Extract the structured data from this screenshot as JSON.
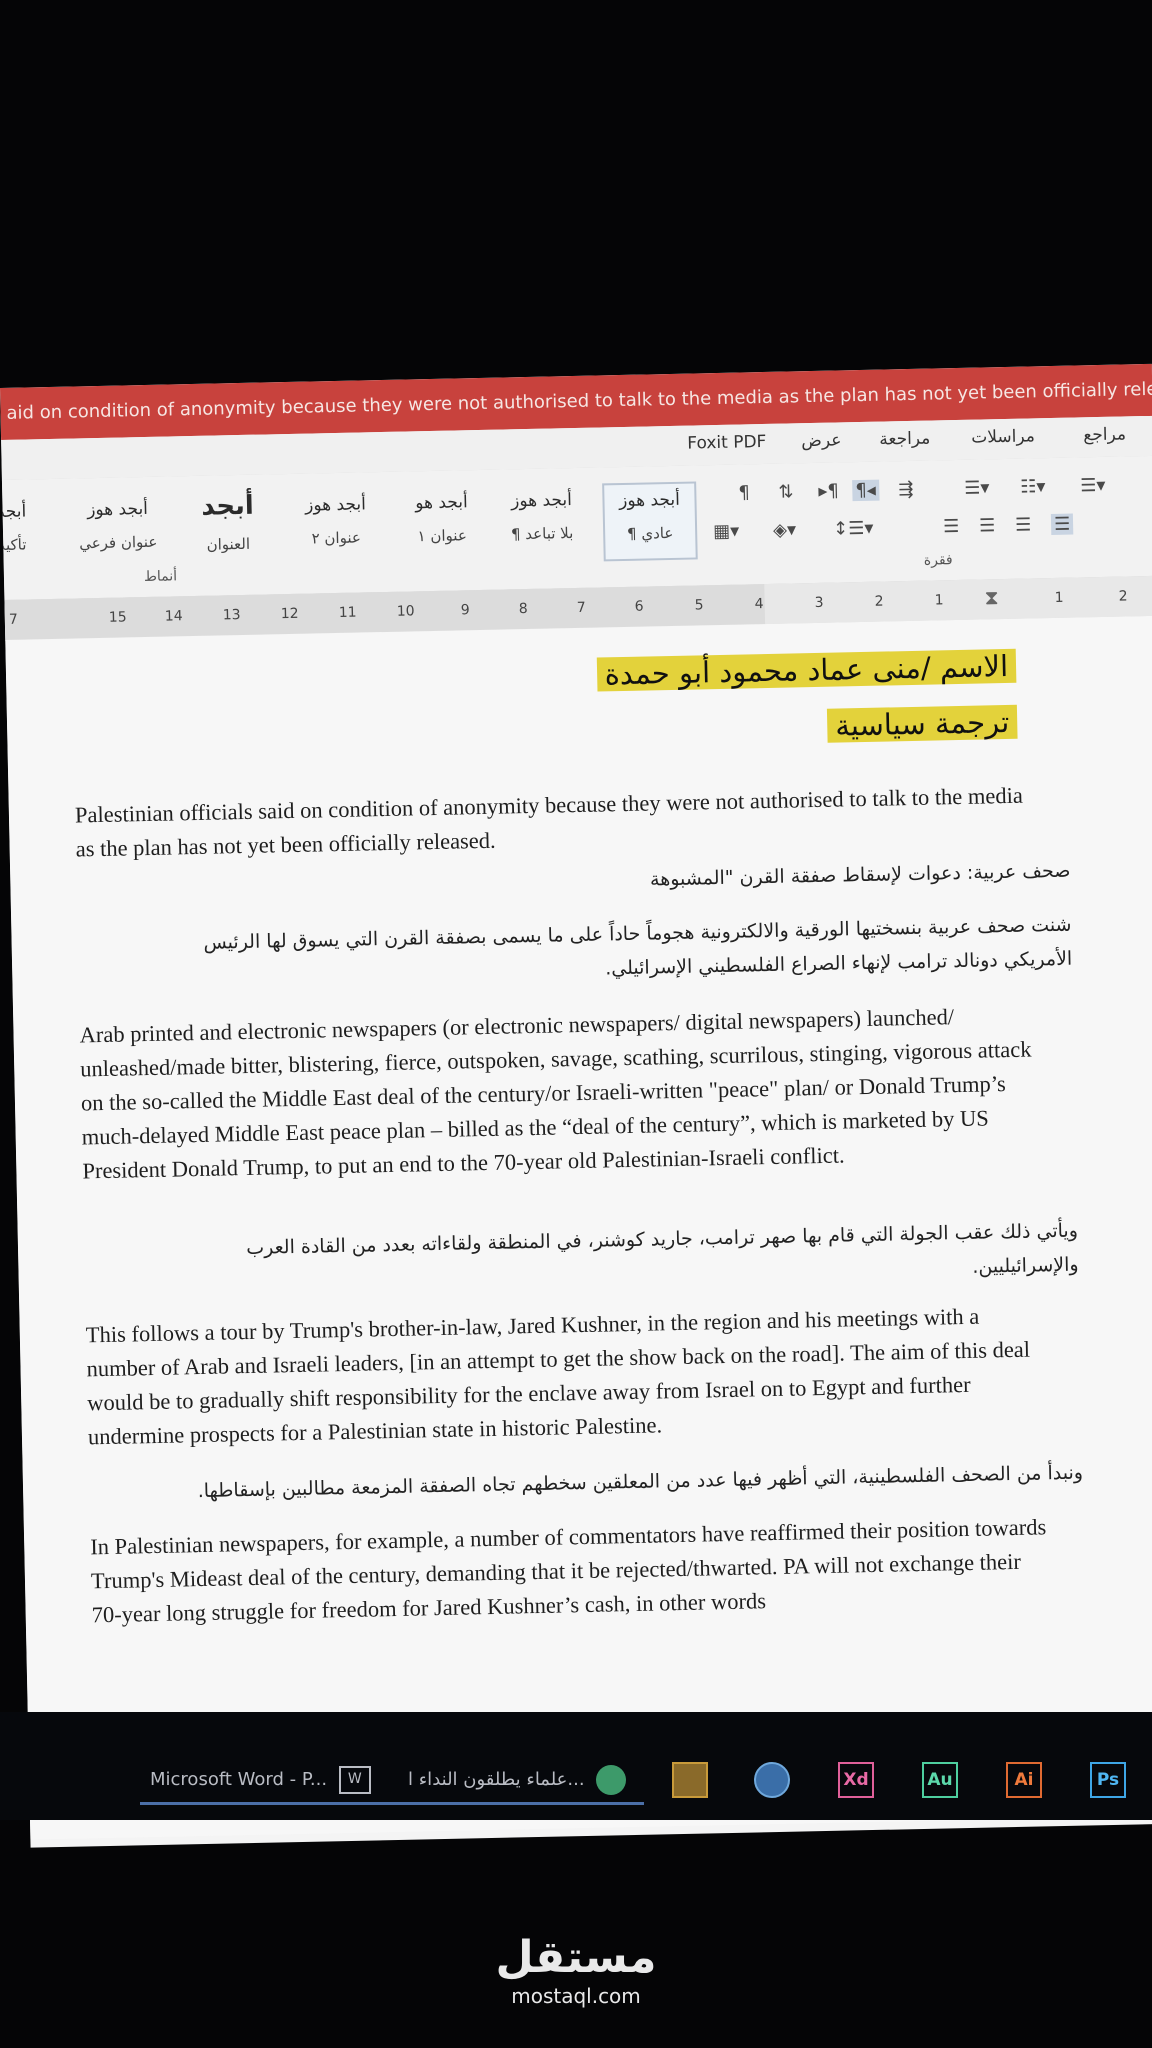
{
  "window": {
    "title": "aid on condition of anonymity because they were not authorised to talk to the media as the plan has not yet been officially released  -  Microsoft"
  },
  "tabs": [
    "مراجع",
    "مراسلات",
    "مراجعة",
    "عرض",
    "Foxit PDF"
  ],
  "styles": {
    "items": [
      {
        "preview": "أبجد هوز",
        "name": "¶ عادي"
      },
      {
        "preview": "أبجد هوز",
        "name": "¶ بلا تباعد"
      },
      {
        "preview": "أبجد هو",
        "name": "عنوان ١"
      },
      {
        "preview": "أبجد هوز",
        "name": "عنوان ٢"
      },
      {
        "preview": "أبجد",
        "name": "العنوان"
      },
      {
        "preview": "أبجد هوز",
        "name": "عنوان فرعي"
      },
      {
        "preview": "أبجد",
        "name": "تأكيد"
      }
    ],
    "group_label": "أنماط",
    "paragraph_label": "فقرة"
  },
  "ruler": {
    "numbers": [
      "2",
      "1",
      "1",
      "2",
      "3",
      "4",
      "5",
      "6",
      "7",
      "8",
      "9",
      "10",
      "11",
      "12",
      "13",
      "14",
      "15",
      "7"
    ]
  },
  "document": {
    "name_line": "الاسم /منى عماد محمود أبو حمدة",
    "subject_line": "ترجمة سياسية",
    "paragraphs": [
      {
        "lang": "en",
        "text": "Palestinian officials said on condition of anonymity because they were not authorised to talk to the media as the plan has not yet been officially released."
      },
      {
        "lang": "ar",
        "text": "صحف عربية: دعوات لإسقاط صفقة القرن \"المشبوهة"
      },
      {
        "lang": "ar",
        "text": "شنت صحف عربية بنسختيها الورقية والالكترونية هجوماً حاداً على ما يسمى بصفقة القرن التي يسوق لها الرئيس الأمريكي دونالد ترامب لإنهاء الصراع الفلسطيني الإسرائيلي."
      },
      {
        "lang": "en",
        "text": "Arab printed and electronic newspapers (or electronic newspapers/ digital newspapers) launched/ unleashed/made bitter, blistering, fierce, outspoken, savage, scathing, scurrilous, stinging, vigorous attack on the so-called the Middle East deal of the century/or Israeli-written \"peace\" plan/ or Donald Trump’s much-delayed Middle East peace plan – billed as the “deal of the century”, which is marketed by US President Donald Trump, to put an end to the 70-year old Palestinian-Israeli conflict."
      },
      {
        "lang": "ar",
        "text": "ويأتي ذلك عقب الجولة التي قام بها صهر ترامب، جاريد كوشنر، في المنطقة ولقاءاته بعدد من القادة العرب والإسرائيليين."
      },
      {
        "lang": "en",
        "text": "This follows a tour by Trump's brother-in-law, Jared Kushner, in the region and his meetings with a number of Arab and Israeli leaders, [in an attempt to get the show back on the road]. The aim of this deal would be to gradually shift responsibility for the enclave away from Israel on to Egypt and further undermine prospects for a Palestinian state in historic Palestine."
      },
      {
        "lang": "ar",
        "text": "ونبدأ من الصحف الفلسطينية، التي أظهر فيها عدد من المعلقين سخطهم تجاه الصفقة المزمعة مطالبين بإسقاطها."
      },
      {
        "lang": "en",
        "text": "In Palestinian newspapers, for example, a number of commentators have reaffirmed their position towards Trump's Mideast deal of the century, demanding that it be rejected/thwarted. PA will not exchange their 70-year long struggle for freedom for Jared Kushner’s cash, in other words"
      }
    ]
  },
  "taskbar": {
    "word_button": "Microsoft Word - P...",
    "browser_button": "علماء يطلقون النداء ا...",
    "apps": [
      "Xd",
      "Au",
      "Ai",
      "Ps"
    ]
  },
  "watermark": {
    "arabic": "مستقل",
    "latin": "mostaql.com"
  }
}
